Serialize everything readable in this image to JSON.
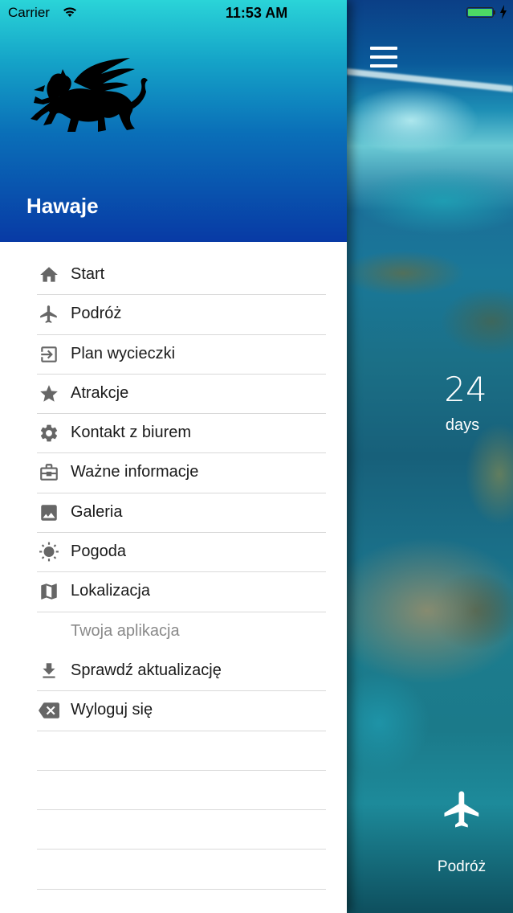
{
  "status_bar": {
    "carrier": "Carrier",
    "time": "11:53 AM",
    "battery_color": "#4cd964"
  },
  "drawer": {
    "title": "Hawaje",
    "logo": "griffin-logo",
    "header_gradient": [
      "#2ad4d8",
      "#083aa5"
    ],
    "items": [
      {
        "label": "Start",
        "icon": "home-icon"
      },
      {
        "label": "Podróż",
        "icon": "airplane-icon"
      },
      {
        "label": "Plan wycieczki",
        "icon": "login-arrow-icon"
      },
      {
        "label": "Atrakcje",
        "icon": "star-icon"
      },
      {
        "label": "Kontakt z biurem",
        "icon": "gear-icon"
      },
      {
        "label": "Ważne informacje",
        "icon": "briefcase-icon"
      },
      {
        "label": "Galeria",
        "icon": "image-icon"
      },
      {
        "label": "Pogoda",
        "icon": "sun-icon"
      },
      {
        "label": "Lokalizacja",
        "icon": "map-icon"
      }
    ],
    "section_header": "Twoja aplikacja",
    "section_items": [
      {
        "label": "Sprawdź aktualizację",
        "icon": "download-icon"
      },
      {
        "label": "Wyloguj się",
        "icon": "backspace-icon"
      }
    ]
  },
  "main": {
    "countdown_value": "24",
    "countdown_unit": "days",
    "bottom_label": "Podróż"
  }
}
